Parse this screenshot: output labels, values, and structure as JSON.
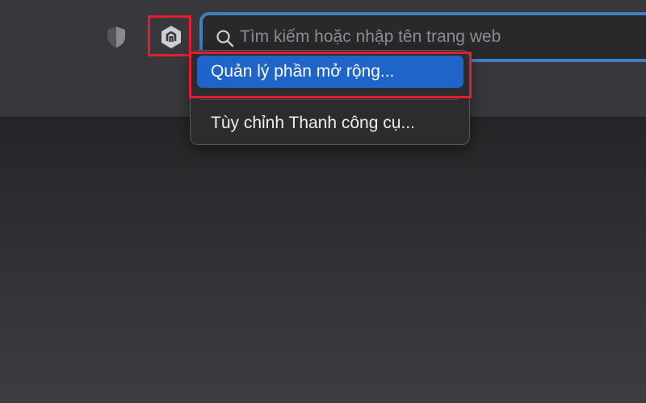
{
  "toolbar": {
    "privacy_icon": "shield-icon",
    "extension_icon": "extension-hexagon-icon"
  },
  "search": {
    "icon": "magnifier-icon",
    "placeholder": "Tìm kiếm hoặc nhập tên trang web",
    "value": ""
  },
  "context_menu": {
    "items": [
      {
        "label": "Quản lý phần mở rộng...",
        "highlighted": true
      },
      {
        "label": "Tùy chỉnh Thanh công cụ...",
        "highlighted": false
      }
    ]
  },
  "colors": {
    "accent": "#1f64c8",
    "focus_ring": "#3f7fc4",
    "annotation": "#e0202e"
  }
}
